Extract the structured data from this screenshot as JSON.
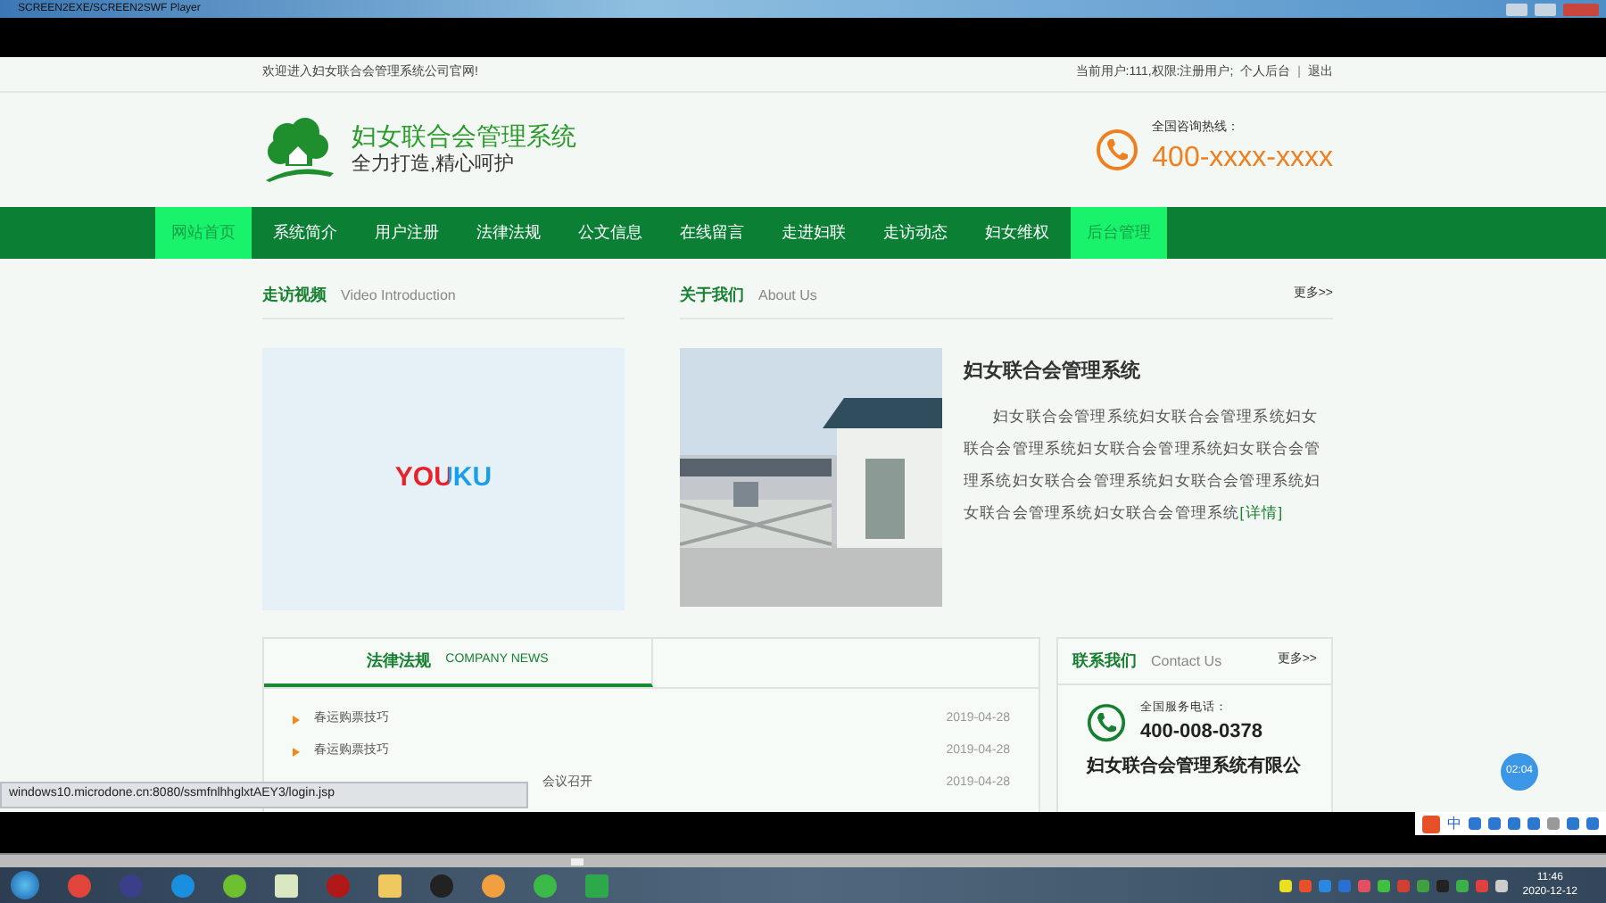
{
  "window": {
    "title": "SCREEN2EXE/SCREEN2SWF Player"
  },
  "topbar": {
    "welcome": "欢迎进入妇女联合会管理系统公司官网!",
    "user": "当前用户:111,权限:注册用户;",
    "links": [
      "个人后台",
      "退出"
    ],
    "separator": "|"
  },
  "header": {
    "title": "妇女联合会管理系统",
    "slogan": "全力打造,精心呵护",
    "hotline_label": "全国咨询热线：",
    "hotline": "400-xxxx-xxxx"
  },
  "nav": [
    {
      "label": "网站首页",
      "selected": true
    },
    {
      "label": "系统简介",
      "selected": false
    },
    {
      "label": "用户注册",
      "selected": false
    },
    {
      "label": "法律法规",
      "selected": false
    },
    {
      "label": "公文信息",
      "selected": false
    },
    {
      "label": "在线留言",
      "selected": false
    },
    {
      "label": "走进妇联",
      "selected": false
    },
    {
      "label": "走访动态",
      "selected": false
    },
    {
      "label": "妇女维权",
      "selected": false
    },
    {
      "label": "后台管理",
      "selected": true
    }
  ],
  "video": {
    "title": "走访视频",
    "subtitle": "Video Introduction",
    "logo": "YOUKU"
  },
  "about": {
    "title": "关于我们",
    "subtitle": "About Us",
    "more": "更多>>",
    "heading": "妇女联合会管理系统",
    "body": "妇女联合会管理系统妇女联合会管理系统妇女联合会管理系统妇女联合会管理系统妇女联合会管理系统妇女联合会管理系统妇女联合会管理系统妇女联合会管理系统妇女联合会管理系统",
    "detail": "[详情]"
  },
  "news": {
    "title": "法律法规",
    "subtitle": "COMPANY NEWS",
    "items": [
      {
        "title": "春运购票技巧",
        "date": "2019-04-28"
      },
      {
        "title": "春运购票技巧",
        "date": "2019-04-28"
      },
      {
        "title": "会议召开",
        "date": "2019-04-28",
        "kind": "partly_hidden"
      }
    ]
  },
  "contact": {
    "title": "联系我们",
    "subtitle": "Contact Us",
    "more": "更多>>",
    "phone_label": "全国服务电话：",
    "phone": "400-008-0378",
    "company": "妇女联合会管理系统有限公"
  },
  "status_url": "windows10.microdone.cn:8080/ssmfnlhhglxtAEY3/login.jsp",
  "timer_badge": "02:04",
  "ime": {
    "mode": "中"
  },
  "clock": {
    "time": "11:46",
    "date": "2020-12-12"
  }
}
